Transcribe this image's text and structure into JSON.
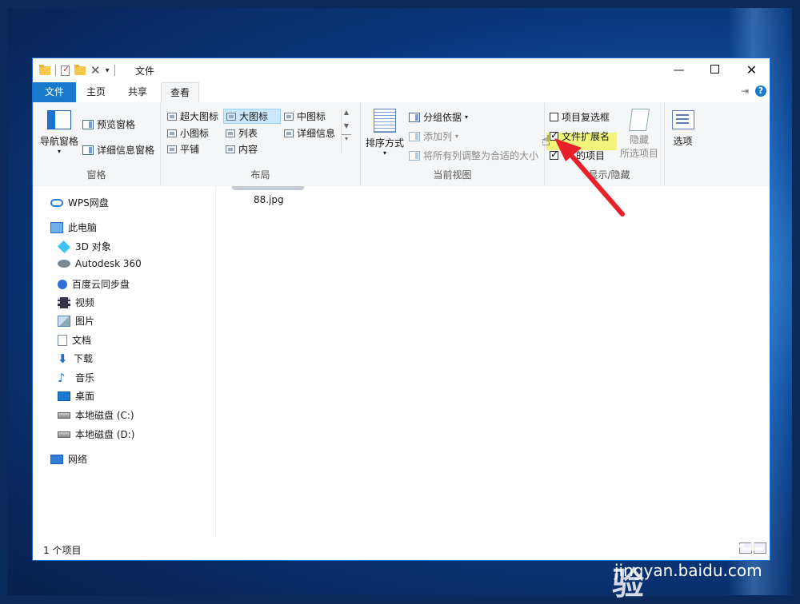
{
  "window": {
    "title": "文件"
  },
  "tabs": [
    {
      "label": "文件"
    },
    {
      "label": "主页"
    },
    {
      "label": "共享"
    },
    {
      "label": "查看"
    }
  ],
  "ribbon": {
    "pane_group": {
      "label": "窗格",
      "nav_pane": "导航窗格",
      "preview_pane": "预览窗格",
      "details_pane": "详细信息窗格"
    },
    "layout_group": {
      "label": "布局",
      "items": [
        "超大图标",
        "大图标",
        "中图标",
        "小图标",
        "列表",
        "详细信息",
        "平铺",
        "内容"
      ],
      "selected": "大图标"
    },
    "current_view_group": {
      "label": "当前视图",
      "sort_by": "排序方式",
      "group_by": "分组依据",
      "add_column": "添加列",
      "fit_columns": "将所有列调整为合适的大小"
    },
    "show_hide_group": {
      "label": "显示/隐藏",
      "label_visible": "显示/隐藏",
      "item_checkboxes": {
        "label": "项目复选框",
        "checked": false
      },
      "file_extensions": {
        "label": "文件扩展名",
        "checked": true
      },
      "hidden_items": {
        "label": "隐藏的项目",
        "label_visible": "的项目",
        "checked": true
      },
      "hide_selected": "隐藏",
      "hide_selected_2": "所选项目"
    },
    "options": {
      "label": "选项"
    }
  },
  "nav": {
    "items": [
      {
        "label": "WPS网盘",
        "icon": "cloud-icon"
      },
      {
        "label": "此电脑",
        "icon": "computer-icon"
      },
      {
        "label": "3D 对象",
        "icon": "cube-icon"
      },
      {
        "label": "Autodesk 360",
        "icon": "autodesk-icon"
      },
      {
        "label": "百度云同步盘",
        "icon": "baidu-cloud-icon"
      },
      {
        "label": "视频",
        "icon": "video-icon"
      },
      {
        "label": "图片",
        "icon": "picture-icon"
      },
      {
        "label": "文档",
        "icon": "document-icon"
      },
      {
        "label": "下载",
        "icon": "download-icon"
      },
      {
        "label": "音乐",
        "icon": "music-icon"
      },
      {
        "label": "桌面",
        "icon": "desktop-icon"
      },
      {
        "label": "本地磁盘 (C:)",
        "icon": "drive-icon"
      },
      {
        "label": "本地磁盘 (D:)",
        "icon": "drive-icon"
      },
      {
        "label": "网络",
        "icon": "network-icon"
      }
    ]
  },
  "content": {
    "files": [
      {
        "name": "88.jpg"
      }
    ]
  },
  "status": {
    "text": "1 个项目"
  },
  "watermark": {
    "logo": "Bai du 经验",
    "url": "jingyan.baidu.com"
  },
  "colors": {
    "accent": "#1979ca",
    "highlight": "#f0f47a",
    "arrow": "#e8202a"
  }
}
